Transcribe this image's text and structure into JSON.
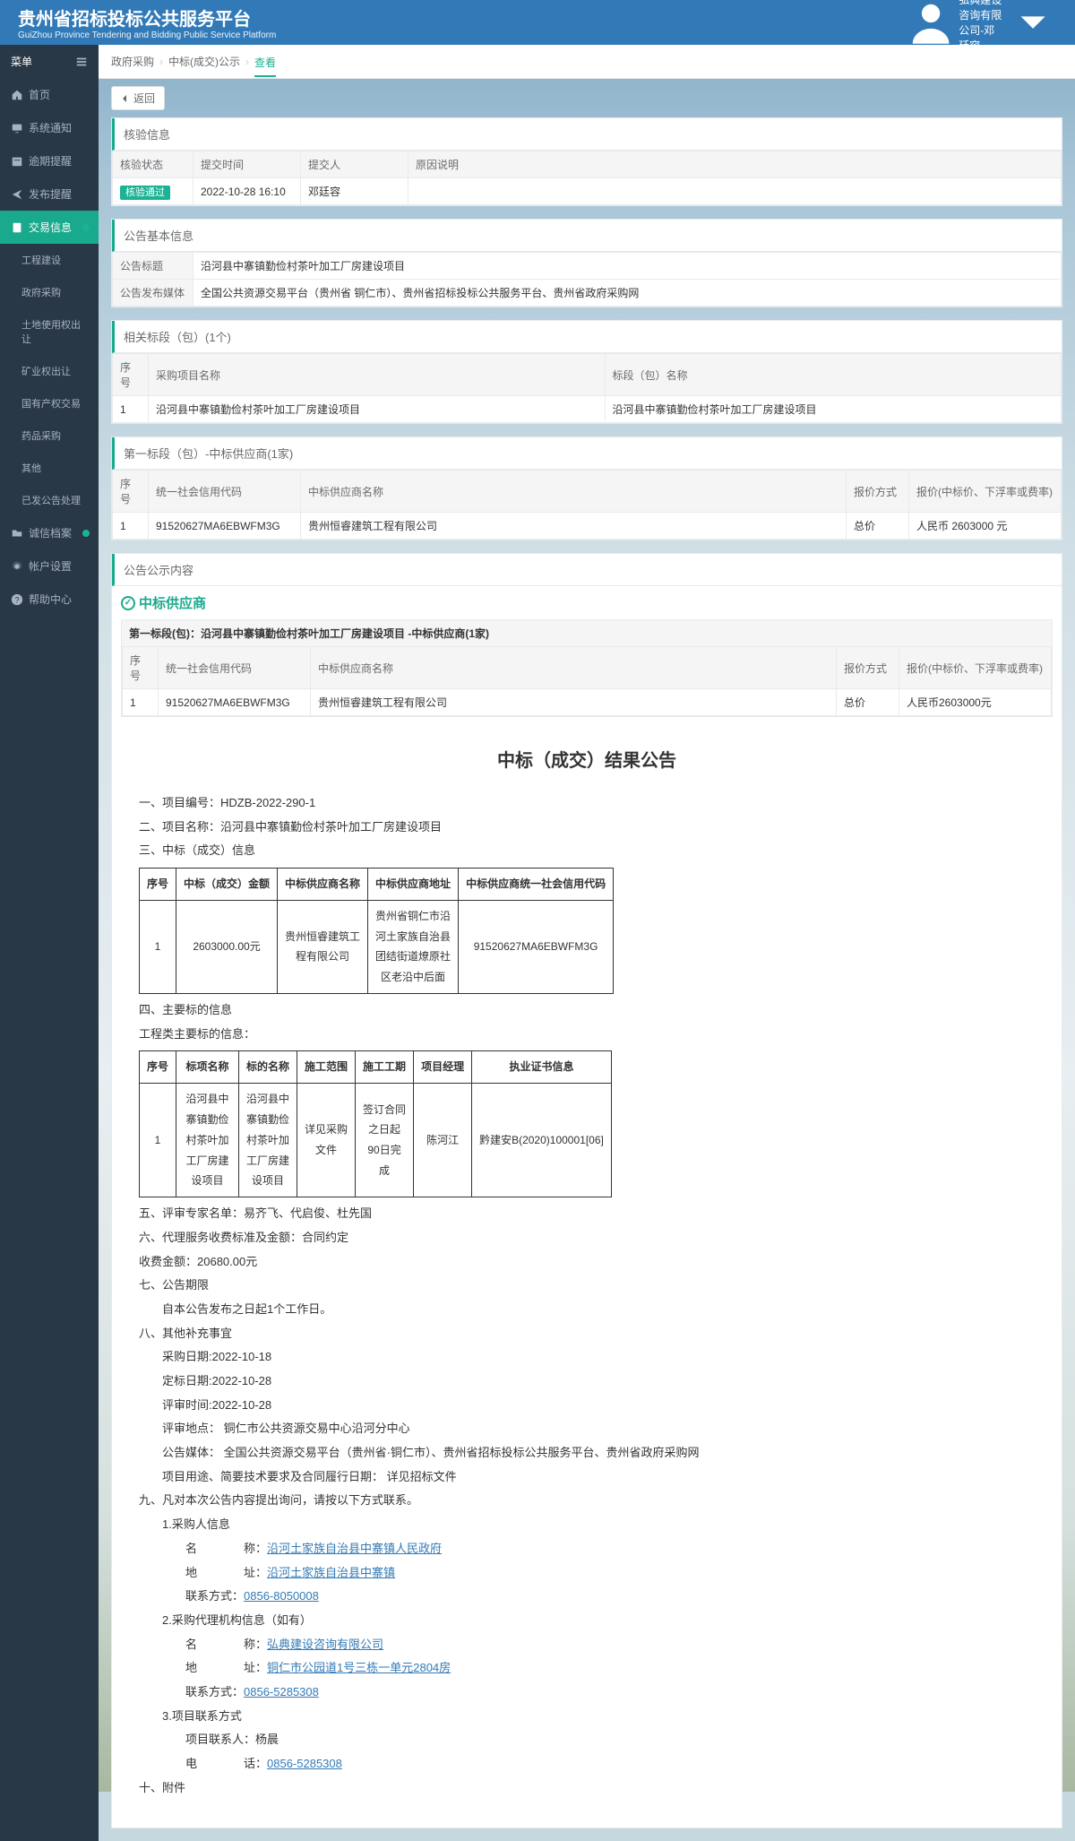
{
  "site": {
    "title": "贵州省招标投标公共服务平台",
    "subtitle": "GuiZhou Province Tendering and Bidding Public Service Platform"
  },
  "user": {
    "name": "弘典建设咨询有限公司-邓廷容"
  },
  "sidebar": {
    "menu": "菜单",
    "items": [
      {
        "label": "首页"
      },
      {
        "label": "系统通知"
      },
      {
        "label": "逾期提醒"
      },
      {
        "label": "发布提醒"
      },
      {
        "label": "交易信息"
      },
      {
        "label": "工程建设"
      },
      {
        "label": "政府采购"
      },
      {
        "label": "土地使用权出让"
      },
      {
        "label": "矿业权出让"
      },
      {
        "label": "国有产权交易"
      },
      {
        "label": "药品采购"
      },
      {
        "label": "其他"
      },
      {
        "label": "已发公告处理"
      },
      {
        "label": "诚信档案"
      },
      {
        "label": "帐户设置"
      },
      {
        "label": "帮助中心"
      }
    ]
  },
  "crumb": {
    "a": "政府采购",
    "b": "中标(成交)公示",
    "c": "查看",
    "back": "返回"
  },
  "verify": {
    "title": "核验信息",
    "h_status": "核验状态",
    "h_time": "提交时间",
    "h_person": "提交人",
    "h_reason": "原因说明",
    "status": "核验通过",
    "time": "2022-10-28 16:10",
    "person": "邓廷容",
    "reason": ""
  },
  "basic": {
    "title": "公告基本信息",
    "h_title": "公告标题",
    "v_title": "沿河县中寨镇勤俭村茶叶加工厂房建设项目",
    "h_media": "公告发布媒体",
    "v_media": "全国公共资源交易平台（贵州省 铜仁市）、贵州省招标投标公共服务平台、贵州省政府采购网"
  },
  "sections": {
    "title": "相关标段（包）(1个)",
    "h_no": "序号",
    "h_name": "采购项目名称",
    "h_pkg": "标段（包）名称",
    "no": "1",
    "name": "沿河县中寨镇勤俭村茶叶加工厂房建设项目",
    "pkg": "沿河县中寨镇勤俭村茶叶加工厂房建设项目"
  },
  "sup": {
    "title": "第一标段（包）-中标供应商(1家)",
    "h_no": "序号",
    "h_code": "统一社会信用代码",
    "h_name": "中标供应商名称",
    "h_method": "报价方式",
    "h_price": "报价(中标价、下浮率或费率)",
    "no": "1",
    "code": "91520627MA6EBWFM3G",
    "name": "贵州恒睿建筑工程有限公司",
    "method": "总价",
    "price": "人民币 2603000 元"
  },
  "content": {
    "title": "公告公示内容",
    "winner": "中标供应商",
    "sub": "第一标段(包)：沿河县中寨镇勤俭村茶叶加工厂房建设项目 -中标供应商(1家)",
    "h_no": "序号",
    "h_code": "统一社会信用代码",
    "h_name": "中标供应商名称",
    "h_method": "报价方式",
    "h_price": "报价(中标价、下浮率或费率)",
    "no": "1",
    "code": "91520627MA6EBWFM3G",
    "name": "贵州恒睿建筑工程有限公司",
    "method": "总价",
    "price": "人民币2603000元"
  },
  "notice": {
    "heading": "中标（成交）结果公告",
    "l1": "一、项目编号：HDZB-2022-290-1",
    "l2": "二、项目名称：沿河县中寨镇勤俭村茶叶加工厂房建设项目",
    "l3": "三、中标（成交）信息",
    "t1": {
      "h_no": "序号",
      "h_amt": "中标（成交）金额",
      "h_name": "中标供应商名称",
      "h_addr": "中标供应商地址",
      "h_code": "中标供应商统一社会信用代码",
      "no": "1",
      "amt": "2603000.00元",
      "name": "贵州恒睿建筑工程有限公司",
      "addr": "贵州省铜仁市沿河土家族自治县团结街道燎原社区老沿中后面",
      "code": "91520627MA6EBWFM3G"
    },
    "l4": "四、主要标的信息",
    "l4b": "工程类主要标的信息：",
    "t2": {
      "h_no": "序号",
      "h_item": "标项名称",
      "h_bname": "标的名称",
      "h_scope": "施工范围",
      "h_period": "施工工期",
      "h_mgr": "项目经理",
      "h_cert": "执业证书信息",
      "no": "1",
      "item": "沿河县中寨镇勤俭村茶叶加工厂房建设项目",
      "bname": "沿河县中寨镇勤俭村茶叶加工厂房建设项目",
      "scope": "详见采购文件",
      "period": "签订合同之日起90日完成",
      "mgr": "陈河江",
      "cert": "黔建安B(2020)100001[06]"
    },
    "l5": "五、评审专家名单：易齐飞、代启俊、杜先国",
    "l6": "六、代理服务收费标准及金额：合同约定",
    "l6b": "收费金额：20680.00元",
    "l7": "七、公告期限",
    "l7b": "自本公告发布之日起1个工作日。",
    "l8": "八、其他补充事宜",
    "l8a": "采购日期:2022-10-18",
    "l8b": "定标日期:2022-10-28",
    "l8c": "评审时间:2022-10-28",
    "l8d": "评审地点：  铜仁市公共资源交易中心沿河分中心",
    "l8e": "公告媒体： 全国公共资源交易平台（贵州省·铜仁市）、贵州省招标投标公共服务平台、贵州省政府采购网",
    "l8f": "项目用途、简要技术要求及合同履行日期：  详见招标文件",
    "l9": "九、凡对本次公告内容提出询问，请按以下方式联系。",
    "l9a": "1.采购人信息",
    "l9a1": "名　　　　称：",
    "l9a1v": "沿河土家族自治县中寨镇人民政府",
    "l9a2": "地　　　　址：",
    "l9a2v": "沿河土家族自治县中寨镇",
    "l9a3": "联系方式：",
    "l9a3v": "0856-8050008",
    "l9b": "2.采购代理机构信息（如有）",
    "l9b1": "名　　　　称：",
    "l9b1v": "弘典建设咨询有限公司",
    "l9b2": "地　　　　址：",
    "l9b2v": "铜仁市公园道1号三栋一单元2804房",
    "l9b3": "联系方式：",
    "l9b3v": "0856-5285308",
    "l9c": "3.项目联系方式",
    "l9c1": "项目联系人：杨晨",
    "l9c2": "电　　　　话：",
    "l9c2v": "0856-5285308",
    "l10": "十、附件"
  }
}
